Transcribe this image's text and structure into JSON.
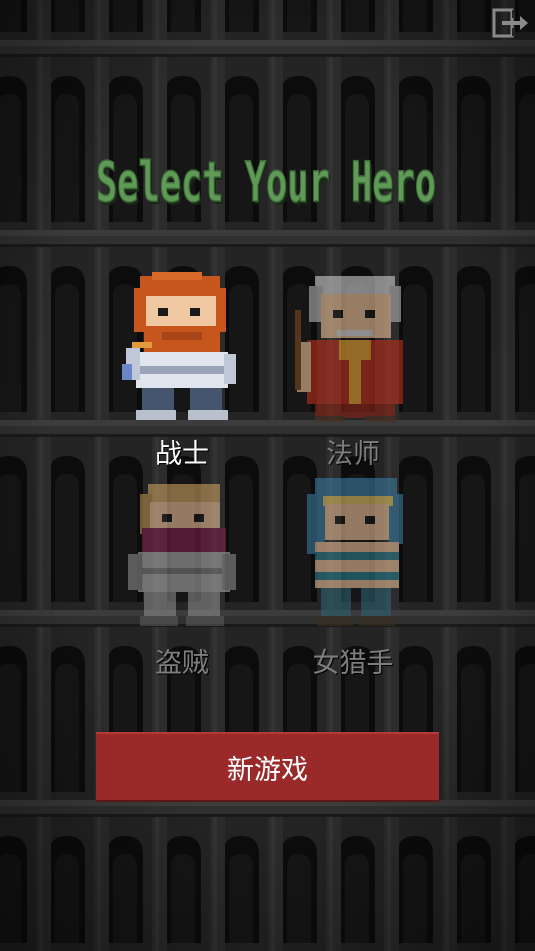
{
  "title": "Select Your Hero",
  "colors": {
    "title_green": "#5f9a57",
    "button_red": "#9a2a2a",
    "label_active": "#ffffff",
    "label_dim": "#7e7e7e"
  },
  "icons": {
    "exit": "exit-door-icon"
  },
  "heroes": [
    {
      "label": "战士",
      "selected": true
    },
    {
      "label": "法师",
      "selected": false
    },
    {
      "label": "盗贼",
      "selected": false
    },
    {
      "label": "女猎手",
      "selected": false
    }
  ],
  "new_game_label": "新游戏"
}
